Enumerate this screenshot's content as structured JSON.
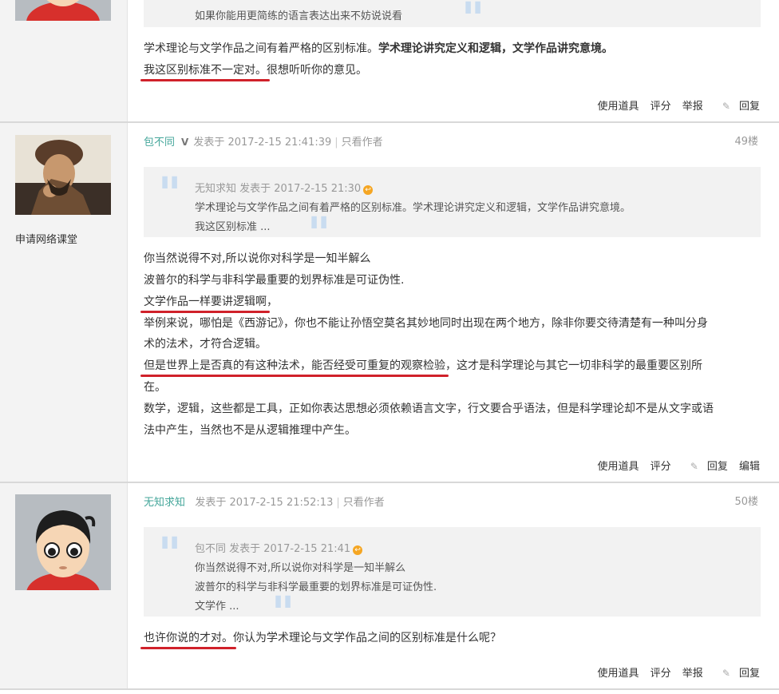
{
  "post_top": {
    "quote_last_line": "如果你能用更简练的语言表达出来不妨说说看",
    "body_line1_plain": "学术理论与文学作品之间有着严格的区别标准。",
    "body_line1_bold": "学术理论讲究定义和逻辑，文学作品讲究意境。",
    "body_line2_underlined": "我这区别标准不一定对。",
    "body_line2_rest": "很想听听你的意见。",
    "actions": [
      "使用道具",
      "评分",
      "举报",
      "回复"
    ]
  },
  "post_49": {
    "author": "包不同",
    "vip_mark": "V",
    "posted": "发表于 2017-2-15 21:41:39",
    "only_author": "只看作者",
    "floor": "49楼",
    "sidebar_link": "申请网络课堂",
    "quote": {
      "author": "无知求知",
      "posted": "发表于 2017-2-15 21:30",
      "lines": [
        "学术理论与文学作品之间有着严格的区别标准。学术理论讲究定义和逻辑，文学作品讲究意境。",
        "我这区别标准 ..."
      ]
    },
    "body": {
      "l1": "你当然说得不对,所以说你对科学是一知半解么",
      "l2": "波普尔的科学与非科学最重要的划界标准是可证伪性.",
      "l3_underlined": "文学作品一样要讲逻辑啊",
      "l3_rest": "，",
      "l4": "举例来说，哪怕是《西游记》，你也不能让孙悟空莫名其妙地同时出现在两个地方，除非你要交待清楚有一种叫分身",
      "l5": "术的法术，才符合逻辑。",
      "l6_underlined": "但是世界上是否真的有这种法术，能否经受可重复的观察检验",
      "l6_rest": "，这才是科学理论与其它一切非科学的最重要区别所",
      "l7": "在。",
      "l8": "数学，逻辑，这些都是工具，正如你表达思想必须依赖语言文字，行文要合乎语法，但是科学理论却不是从文字或语",
      "l9": "法中产生，当然也不是从逻辑推理中产生。"
    },
    "actions": [
      "使用道具",
      "评分",
      "回复",
      "编辑"
    ]
  },
  "post_50": {
    "author": "无知求知",
    "posted": "发表于 2017-2-15 21:52:13",
    "only_author": "只看作者",
    "floor": "50楼",
    "quote": {
      "author": "包不同",
      "posted": "发表于 2017-2-15 21:41",
      "lines": [
        "你当然说得不对,所以说你对科学是一知半解么",
        "波普尔的科学与非科学最重要的划界标准是可证伪性.",
        "文学作 ..."
      ]
    },
    "body_underlined": "也许你说的才对。",
    "body_rest": "你认为学术理论与文学作品之间的区别标准是什么呢？",
    "actions": [
      "使用道具",
      "评分",
      "举报",
      "回复"
    ]
  },
  "colors": {
    "author_link": "#44a69a",
    "underline_annotation": "#d0212a",
    "quote_bg": "#f2f2f2",
    "quote_mark": "#c9dcf0",
    "sidebar_bg": "#f3f3f3"
  }
}
